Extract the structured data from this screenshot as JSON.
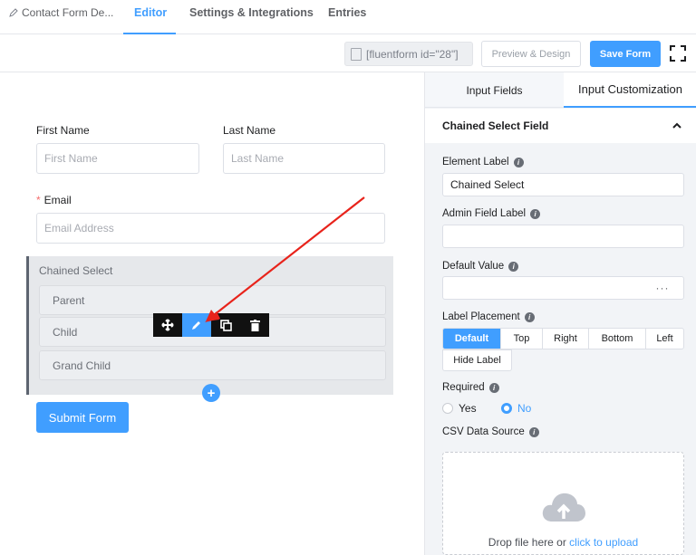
{
  "topbar": {
    "breadcrumb": "Contact Form De...",
    "tabs": [
      {
        "label": "Editor",
        "active": true
      },
      {
        "label": "Settings & Integrations",
        "active": false
      },
      {
        "label": "Entries",
        "active": false
      }
    ],
    "shortcode": "[fluentform id=\"28\"]",
    "preview_label": "Preview & Design",
    "save_label": "Save Form"
  },
  "form": {
    "first_name": {
      "label": "First Name",
      "placeholder": "First Name"
    },
    "last_name": {
      "label": "Last Name",
      "placeholder": "Last Name"
    },
    "email": {
      "label": "Email",
      "placeholder": "Email Address",
      "required_mark": "*"
    },
    "chained_select": {
      "label": "Chained Select",
      "items": [
        "Parent",
        "Child",
        "Grand Child"
      ]
    },
    "submit_label": "Submit Form",
    "toolbar_icons": [
      "move-icon",
      "edit-icon",
      "duplicate-icon",
      "delete-icon"
    ]
  },
  "panel": {
    "tabs": [
      "Input Fields",
      "Input Customization"
    ],
    "section_title": "Chained Select Field",
    "element_label": {
      "label": "Element Label",
      "value": "Chained Select"
    },
    "admin_label": {
      "label": "Admin Field Label",
      "value": ""
    },
    "default_value": {
      "label": "Default Value",
      "value": "",
      "button": "···"
    },
    "label_placement": {
      "label": "Label Placement",
      "options": [
        "Default",
        "Top",
        "Right",
        "Bottom",
        "Left"
      ],
      "selected": "Default",
      "hide_label": "Hide Label"
    },
    "required": {
      "label": "Required",
      "yes": "Yes",
      "no": "No",
      "selected": "No"
    },
    "csv": {
      "label": "CSV Data Source",
      "drop_text": "Drop file here or ",
      "link_text": "click to upload"
    }
  },
  "colors": {
    "accent": "#409eff",
    "annotation": "#e8231b"
  }
}
